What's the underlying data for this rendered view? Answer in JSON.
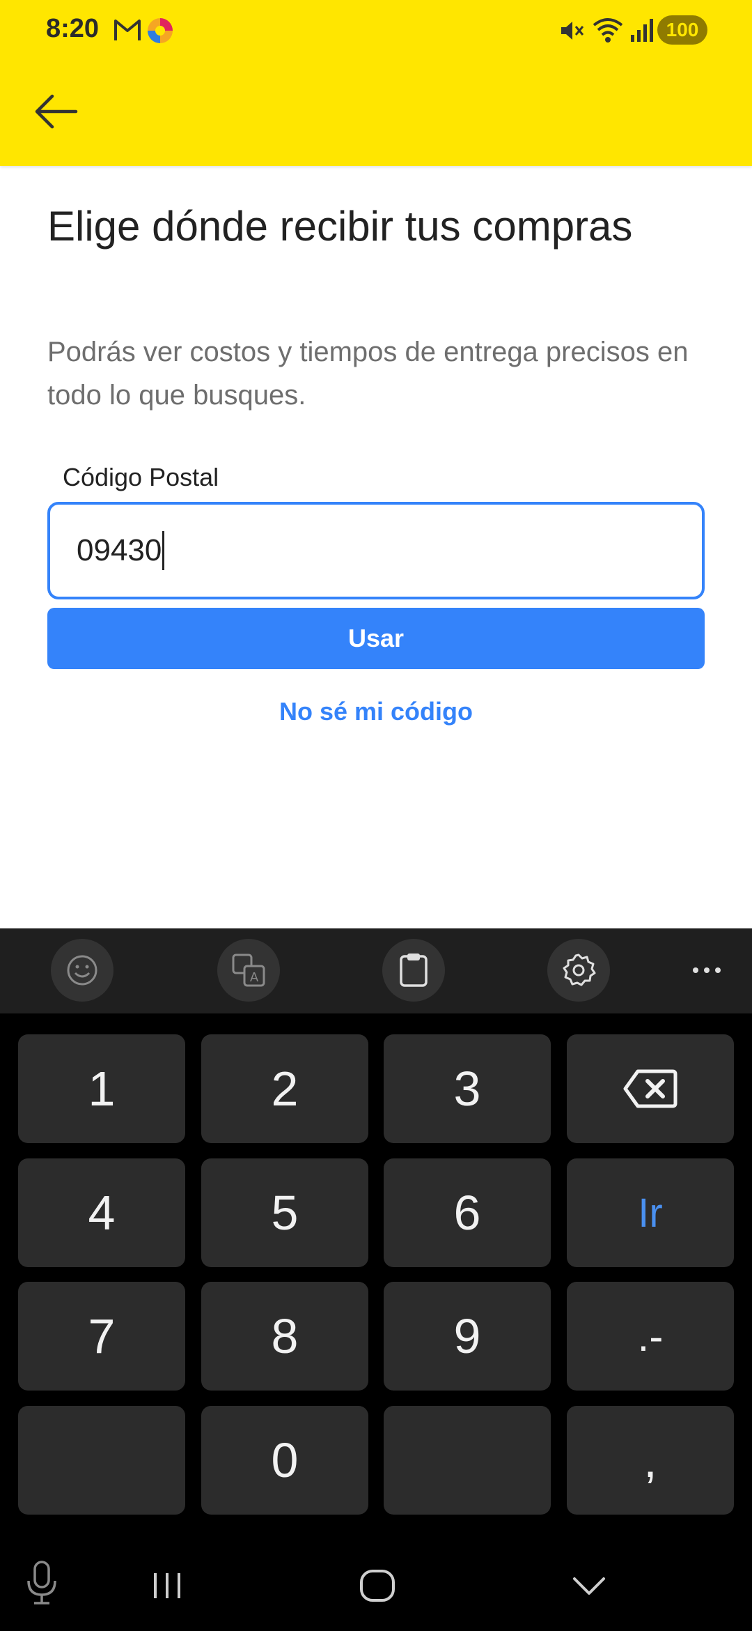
{
  "status_bar": {
    "time": "8:20",
    "battery": "100"
  },
  "header": {
    "back_icon": "arrow-left-icon",
    "background": "#FFE600"
  },
  "main": {
    "title": "Elige dónde recibir tus compras",
    "subtitle": "Podrás ver costos y tiempos de entrega precisos en todo lo que busques.",
    "postal_label": "Código Postal",
    "postal_value": "09430",
    "use_button": "Usar",
    "unknown_link": "No sé mi código",
    "accent": "#3483FA"
  },
  "keyboard": {
    "toolbar_icons": [
      "emoji-icon",
      "translate-icon",
      "clipboard-icon",
      "settings-icon",
      "more-icon"
    ],
    "keys": {
      "k1": "1",
      "k2": "2",
      "k3": "3",
      "k4": "4",
      "k5": "5",
      "k6": "6",
      "go": "Ir",
      "k7": "7",
      "k8": "8",
      "k9": "9",
      "dotdash": ".-",
      "k0": "0",
      "comma": ","
    }
  },
  "nav_bar": {
    "icons": [
      "microphone-icon",
      "recent-apps-icon",
      "home-icon",
      "hide-keyboard-icon"
    ]
  }
}
